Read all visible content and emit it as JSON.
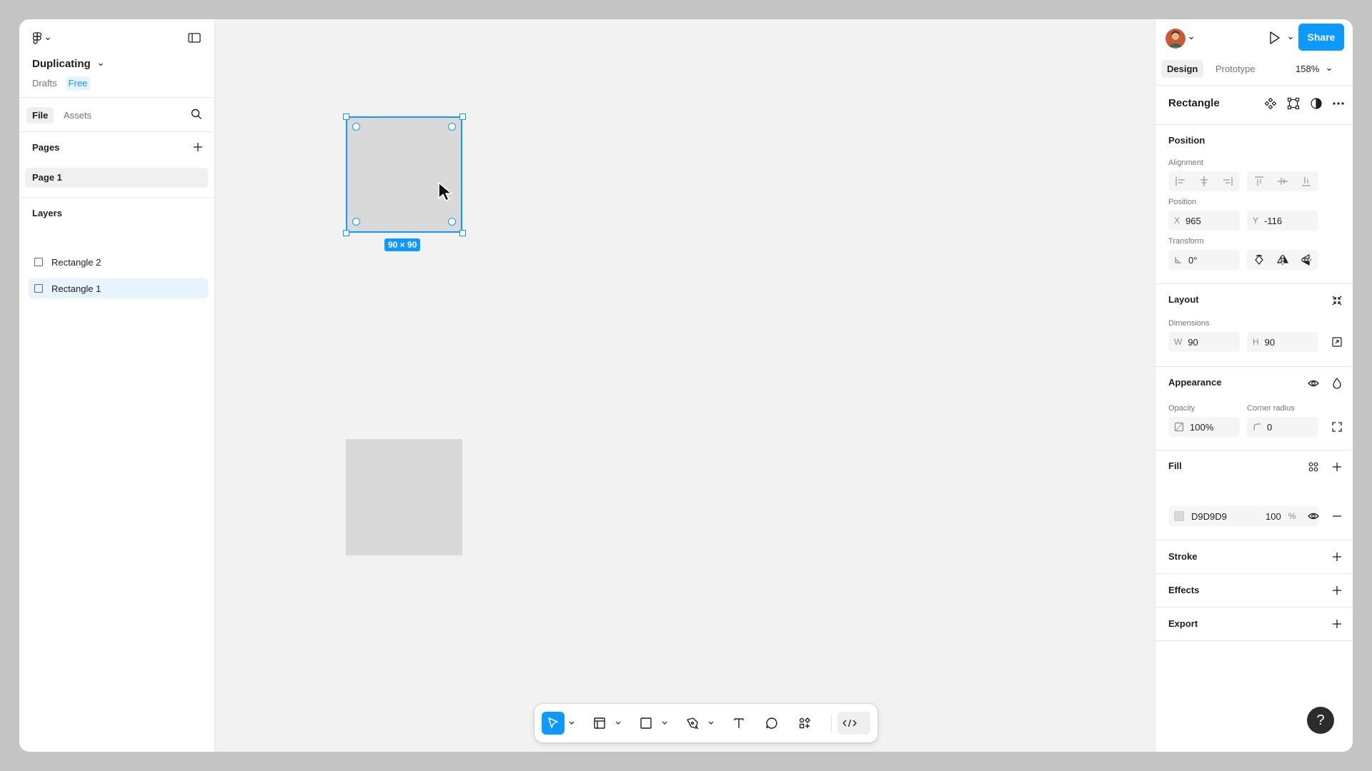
{
  "file": {
    "title": "Duplicating",
    "location": "Drafts",
    "plan_badge": "Free"
  },
  "left_tabs": {
    "file": "File",
    "assets": "Assets"
  },
  "pages": {
    "heading": "Pages",
    "items": [
      "Page 1"
    ]
  },
  "layers": {
    "heading": "Layers",
    "items": [
      "Rectangle 2",
      "Rectangle 1"
    ],
    "selected": "Rectangle 1"
  },
  "canvas": {
    "selection_size": "90 × 90",
    "fill_color": "#D9D9D9",
    "selection_color": "#0D99FF"
  },
  "toolbar": {
    "tools": [
      "move-tool",
      "frame-tool",
      "rectangle-tool",
      "pen-tool",
      "text-tool",
      "comment-tool",
      "actions-tool",
      "dev-mode-toggle"
    ],
    "active": "move-tool"
  },
  "right": {
    "share_label": "Share",
    "tabs": {
      "design": "Design",
      "prototype": "Prototype"
    },
    "zoom": "158%",
    "selection_title": "Rectangle",
    "position": {
      "heading": "Position",
      "alignment_label": "Alignment",
      "position_label": "Position",
      "x_prefix": "X",
      "x": "965",
      "y_prefix": "Y",
      "y": "-116",
      "transform_label": "Transform",
      "rotation": "0°"
    },
    "layout": {
      "heading": "Layout",
      "dimensions_label": "Dimensions",
      "w_prefix": "W",
      "w": "90",
      "h_prefix": "H",
      "h": "90"
    },
    "appearance": {
      "heading": "Appearance",
      "opacity_label": "Opacity",
      "opacity": "100%",
      "radius_label": "Corner radius",
      "radius": "0"
    },
    "fill": {
      "heading": "Fill",
      "hex": "D9D9D9",
      "opacity": "100",
      "pct": "%"
    },
    "stroke": {
      "heading": "Stroke"
    },
    "effects": {
      "heading": "Effects"
    },
    "export": {
      "heading": "Export"
    },
    "help": "?"
  },
  "colors": {
    "accent": "#0d99ff",
    "panel": "#ffffff",
    "canvas": "#f2f2f2"
  }
}
